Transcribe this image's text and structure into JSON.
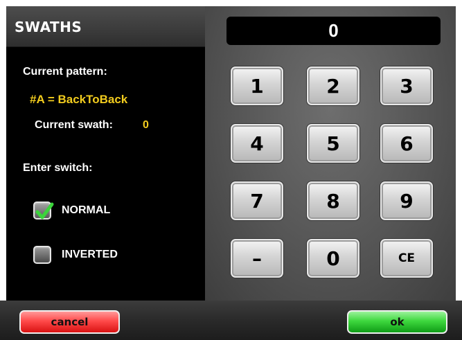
{
  "panel": {
    "title": "SWATHS",
    "current_pattern_label": "Current pattern:",
    "pattern_value": "#A = BackToBack",
    "current_swath_label": "Current swath:",
    "current_swath_value": "0",
    "enter_switch_label": "Enter switch:",
    "options": [
      {
        "label": "NORMAL",
        "checked": true,
        "icon": "check-icon"
      },
      {
        "label": "INVERTED",
        "checked": false
      }
    ]
  },
  "keypad": {
    "display_value": "0",
    "keys": [
      "1",
      "2",
      "3",
      "4",
      "5",
      "6",
      "7",
      "8",
      "9",
      "–",
      "0",
      "CE"
    ]
  },
  "footer": {
    "cancel_label": "cancel",
    "ok_label": "ok"
  },
  "colors": {
    "highlight_text": "#f2cc1e",
    "cancel": "#ff4a4a",
    "ok": "#3ed83e",
    "checkmark": "#3bd43b"
  }
}
